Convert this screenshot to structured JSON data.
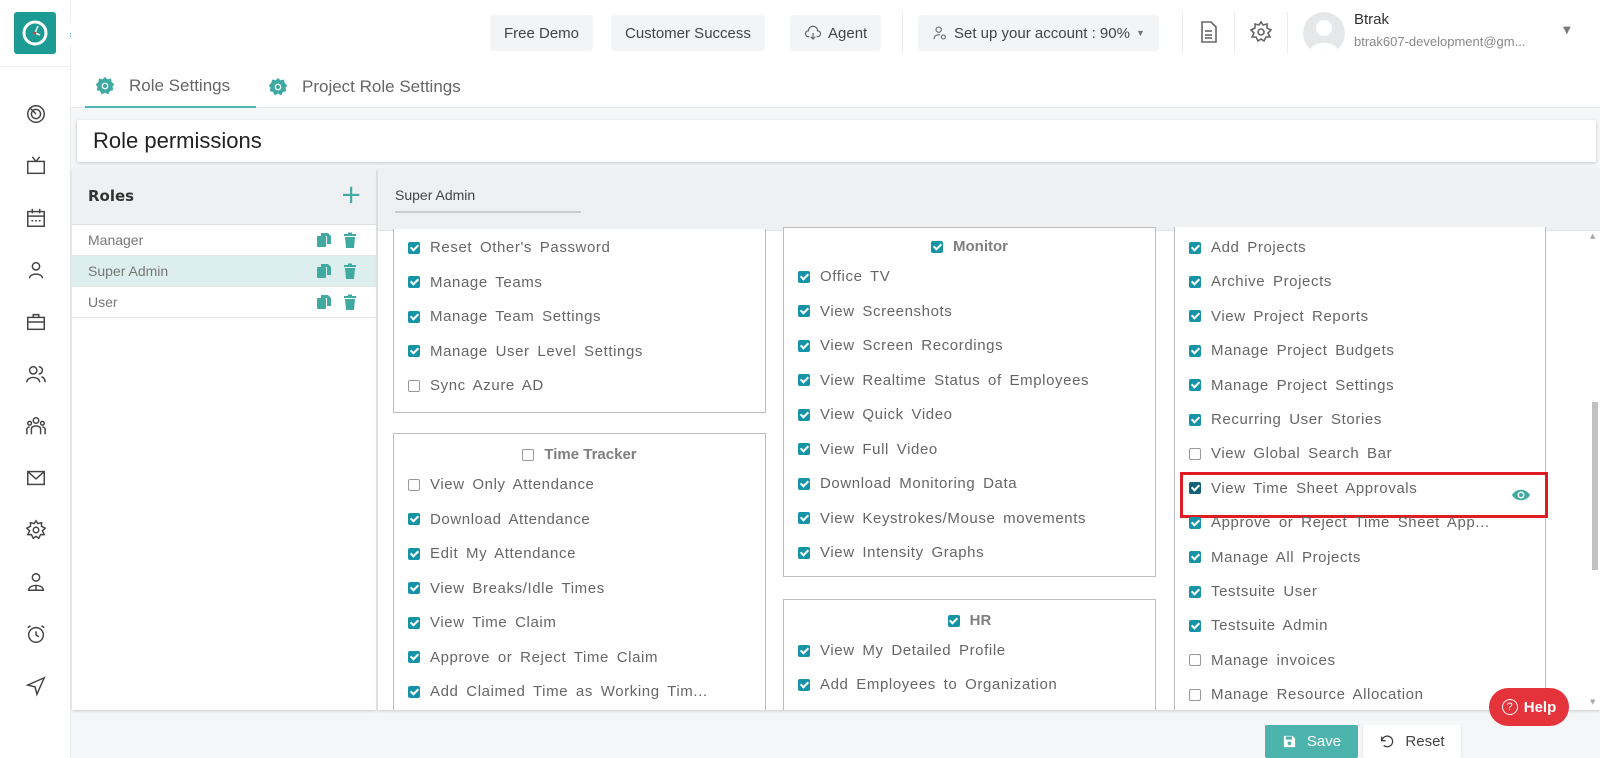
{
  "app": {
    "logo_icon": "clock-icon",
    "expand_icon": "triple-chevron-right-icon"
  },
  "sidebar": {
    "items": [
      {
        "icon": "dashboard-icon",
        "label": "Dashboard"
      },
      {
        "icon": "tv-icon",
        "label": "Office TV"
      },
      {
        "icon": "calendar-icon",
        "label": "Calendar"
      },
      {
        "icon": "user-icon",
        "label": "Profile"
      },
      {
        "icon": "briefcase-icon",
        "label": "Projects"
      },
      {
        "icon": "users-icon",
        "label": "Team"
      },
      {
        "icon": "group-icon",
        "label": "HR"
      },
      {
        "icon": "mail-icon",
        "label": "Messages"
      },
      {
        "icon": "settings-icon",
        "label": "Settings"
      },
      {
        "icon": "user-tie-icon",
        "label": "Employees"
      },
      {
        "icon": "alarm-icon",
        "label": "Time"
      },
      {
        "icon": "send-icon",
        "label": "Send"
      }
    ]
  },
  "header": {
    "free_demo": "Free Demo",
    "customer_success": "Customer Success",
    "agent": "Agent",
    "setup_account": "Set up your account : 90%",
    "user_name": "Btrak",
    "user_email": "btrak607-development@gm..."
  },
  "tabs": [
    {
      "label": "Role Settings",
      "active": true
    },
    {
      "label": "Project Role Settings",
      "active": false
    }
  ],
  "page_title": "Role permissions",
  "roles": {
    "heading": "Roles",
    "add_label": "+",
    "list": [
      {
        "name": "Manager",
        "selected": false
      },
      {
        "name": "Super Admin",
        "selected": true
      },
      {
        "name": "User",
        "selected": false
      }
    ]
  },
  "permissions": {
    "role_name": "Super Admin",
    "column1": {
      "top_items": [
        {
          "label": "Reset Other's Password",
          "checked": true
        },
        {
          "label": "Manage Teams",
          "checked": true
        },
        {
          "label": "Manage Team Settings",
          "checked": true
        },
        {
          "label": "Manage User Level Settings",
          "checked": true
        },
        {
          "label": "Sync Azure AD",
          "checked": false
        }
      ],
      "time_tracker": {
        "title": "Time Tracker",
        "checked": false,
        "items": [
          {
            "label": "View Only Attendance",
            "checked": false
          },
          {
            "label": "Download Attendance",
            "checked": true
          },
          {
            "label": "Edit My Attendance",
            "checked": true
          },
          {
            "label": "View Breaks/Idle Times",
            "checked": true
          },
          {
            "label": "View Time Claim",
            "checked": true
          },
          {
            "label": "Approve or Reject Time Claim",
            "checked": true
          },
          {
            "label": "Add Claimed Time as Working Tim...",
            "checked": true
          }
        ]
      }
    },
    "column2": {
      "monitor": {
        "title": "Monitor",
        "checked": true,
        "items": [
          {
            "label": "Office TV",
            "checked": true
          },
          {
            "label": "View Screenshots",
            "checked": true
          },
          {
            "label": "View Screen Recordings",
            "checked": true
          },
          {
            "label": "View Realtime Status of Employees",
            "checked": true
          },
          {
            "label": "View Quick Video",
            "checked": true
          },
          {
            "label": "View Full Video",
            "checked": true
          },
          {
            "label": "Download Monitoring Data",
            "checked": true
          },
          {
            "label": "View Keystrokes/Mouse movements",
            "checked": true
          },
          {
            "label": "View Intensity Graphs",
            "checked": true
          }
        ]
      },
      "hr": {
        "title": "HR",
        "checked": true,
        "items": [
          {
            "label": "View My Detailed Profile",
            "checked": true
          },
          {
            "label": "Add Employees to Organization",
            "checked": true
          }
        ]
      }
    },
    "column3": {
      "items": [
        {
          "label": "Add Projects",
          "checked": true
        },
        {
          "label": "Archive Projects",
          "checked": true
        },
        {
          "label": "View Project Reports",
          "checked": true
        },
        {
          "label": "Manage Project Budgets",
          "checked": true
        },
        {
          "label": "Manage Project Settings",
          "checked": true
        },
        {
          "label": "Recurring User Stories",
          "checked": true
        },
        {
          "label": "View Global Search Bar",
          "checked": false
        },
        {
          "label": "View Time Sheet Approvals",
          "checked": true,
          "highlighted": true
        },
        {
          "label": "Approve or Reject Time Sheet App...",
          "checked": true
        },
        {
          "label": "Manage All Projects",
          "checked": true
        },
        {
          "label": "Testsuite User",
          "checked": true
        },
        {
          "label": "Testsuite Admin",
          "checked": true
        },
        {
          "label": "Manage invoices",
          "checked": false
        },
        {
          "label": "Manage Resource Allocation",
          "checked": false
        }
      ]
    }
  },
  "footer": {
    "save": "Save",
    "reset": "Reset",
    "help": "Help"
  },
  "colors": {
    "accent": "#1c9a94",
    "checkbox": "#1694a7",
    "highlight": "#e01b24",
    "help": "#e5333b",
    "save": "#4cb3ad"
  }
}
